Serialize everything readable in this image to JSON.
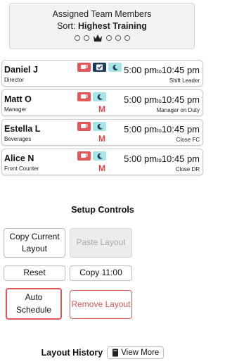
{
  "sort_panel": {
    "title": "Assigned Team Members",
    "sort_prefix": "Sort: ",
    "sort_value": "Highest Training",
    "dots": [
      "inactive",
      "inactive",
      "active-crown",
      "inactive",
      "inactive",
      "inactive"
    ]
  },
  "members": [
    {
      "name": "Daniel J",
      "role": "Director",
      "icons": [
        "coffee-icon",
        "check-icon",
        "moon-icon"
      ],
      "mark": "",
      "start": "5:00 pm",
      "to": "to",
      "end": "10:45 pm",
      "position": "Shift Leader"
    },
    {
      "name": "Matt O",
      "role": "Manager",
      "icons": [
        "coffee-icon",
        "moon-icon"
      ],
      "mark": "M",
      "start": "5:00 pm",
      "to": "to",
      "end": "10:45 pm",
      "position": "Manager on Duty"
    },
    {
      "name": "Estella L",
      "role": "Beverages",
      "icons": [
        "coffee-icon",
        "moon-icon"
      ],
      "mark": "M",
      "start": "5:00 pm",
      "to": "to",
      "end": "10:45 pm",
      "position": "Close FC"
    },
    {
      "name": "Alice N",
      "role": "Front Counter",
      "icons": [
        "coffee-icon",
        "moon-icon"
      ],
      "mark": "M",
      "start": "5:00 pm",
      "to": "to",
      "end": "10:45 pm",
      "position": "Close DR"
    }
  ],
  "setup": {
    "title": "Setup Controls",
    "copy_current_layout": "Copy Current Layout",
    "paste_layout": "Paste Layout",
    "reset": "Reset",
    "copy_time": "Copy 11:00",
    "auto_schedule": "Auto Schedule",
    "remove_layout": "Remove Layout"
  },
  "history": {
    "title": "Layout History",
    "view_more": "View More"
  },
  "colors": {
    "accent_red": "#e05659",
    "icon_cup": "#e2585a",
    "icon_check": "#1f3b5c",
    "icon_moon": "#a6e4e6"
  }
}
